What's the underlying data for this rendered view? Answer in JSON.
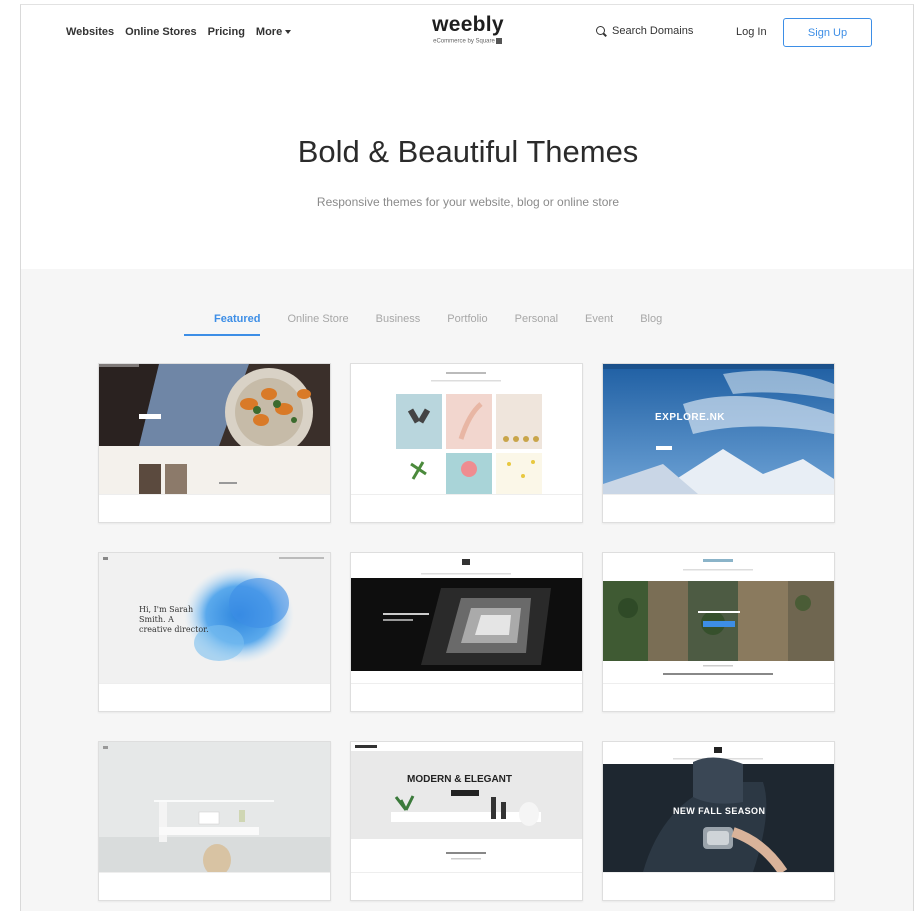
{
  "header": {
    "nav": [
      "Websites",
      "Online Stores",
      "Pricing",
      "More"
    ],
    "brand_name": "weebly",
    "brand_sub": "eCommerce by Square",
    "search": "Search Domains",
    "login": "Log In",
    "signup": "Sign Up"
  },
  "hero": {
    "title": "Bold & Beautiful Themes",
    "subtitle": "Responsive themes for your website, blog or online store"
  },
  "tabs": [
    "Featured",
    "Online Store",
    "Business",
    "Portfolio",
    "Personal",
    "Event",
    "Blog"
  ],
  "active_tab": "Featured",
  "themes": {
    "t3_title": "EXPLORE.NK",
    "t4_heading": "Hi, I'm Sarah Smith. A creative director.",
    "t8_title": "MODERN & ELEGANT",
    "t9_title": "NEW FALL SEASON"
  },
  "colors": {
    "accent": "#3d8ee6",
    "gallery_bg": "#f6f6f6"
  }
}
